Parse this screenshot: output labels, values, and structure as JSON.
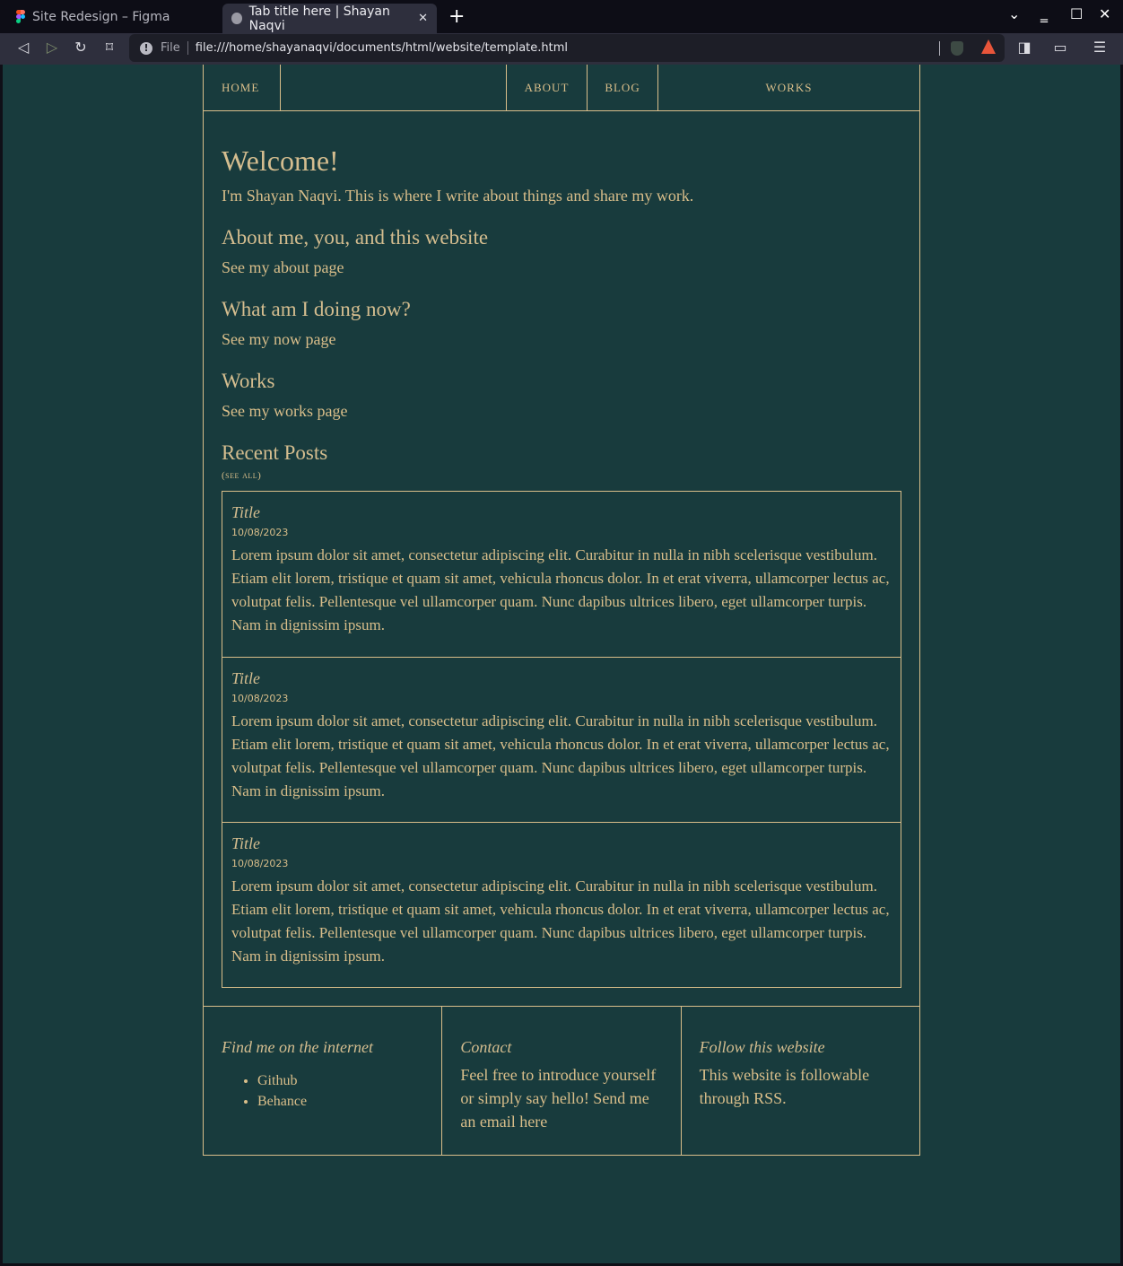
{
  "browser": {
    "tabs": [
      {
        "title": "Site Redesign – Figma",
        "icon": "figma-icon",
        "active": false
      },
      {
        "title": "Tab title here | Shayan Naqvi",
        "icon": "globe-icon",
        "active": true
      }
    ],
    "new_tab_icon": "plus-icon",
    "window_controls": [
      "chevron-down-icon",
      "minimize-icon",
      "maximize-icon",
      "close-icon"
    ],
    "toolbar": {
      "back_icon": "back-icon",
      "forward_icon": "forward-icon",
      "reload_icon": "reload-icon",
      "bookmark_icon": "bookmark-icon",
      "url_scheme_label": "File",
      "url": "file:///home/shayanaqvi/documents/html/website/template.html",
      "extensions": [
        "brave-shields-icon",
        "brave-rewards-icon"
      ],
      "right_icons": [
        "sidebar-icon",
        "wallet-icon",
        "menu-icon"
      ]
    }
  },
  "site": {
    "nav": {
      "home": "HOME",
      "about": "ABOUT",
      "blog": "BLOG",
      "works": "WORKS"
    },
    "welcome": {
      "heading": "Welcome!",
      "intro": "I'm Shayan Naqvi. This is where I write about things and share my work."
    },
    "sections": [
      {
        "heading": "About me, you, and this website",
        "link": "See my about page"
      },
      {
        "heading": "What am I doing now?",
        "link": "See my now page"
      },
      {
        "heading": "Works",
        "link": "See my works page"
      }
    ],
    "recent_posts": {
      "heading": "Recent Posts",
      "see_all": "(see all)",
      "posts": [
        {
          "title": "Title",
          "date": "10/08/2023",
          "body": "Lorem ipsum dolor sit amet, consectetur adipiscing elit. Curabitur in nulla in nibh scelerisque vestibulum. Etiam elit lorem, tristique et quam sit amet, vehicula rhoncus dolor. In et erat viverra, ullamcorper lectus ac, volutpat felis. Pellentesque vel ullamcorper quam. Nunc dapibus ultrices libero, eget ullamcorper turpis. Nam in dignissim ipsum."
        },
        {
          "title": "Title",
          "date": "10/08/2023",
          "body": "Lorem ipsum dolor sit amet, consectetur adipiscing elit. Curabitur in nulla in nibh scelerisque vestibulum. Etiam elit lorem, tristique et quam sit amet, vehicula rhoncus dolor. In et erat viverra, ullamcorper lectus ac, volutpat felis. Pellentesque vel ullamcorper quam. Nunc dapibus ultrices libero, eget ullamcorper turpis. Nam in dignissim ipsum."
        },
        {
          "title": "Title",
          "date": "10/08/2023",
          "body": "Lorem ipsum dolor sit amet, consectetur adipiscing elit. Curabitur in nulla in nibh scelerisque vestibulum. Etiam elit lorem, tristique et quam sit amet, vehicula rhoncus dolor. In et erat viverra, ullamcorper lectus ac, volutpat felis. Pellentesque vel ullamcorper quam. Nunc dapibus ultrices libero, eget ullamcorper turpis. Nam in dignissim ipsum."
        }
      ]
    },
    "footer": {
      "internet": {
        "heading": "Find me on the internet",
        "links": [
          "Github",
          "Behance"
        ]
      },
      "contact": {
        "heading": "Contact",
        "text": "Feel free to introduce yourself or simply say hello! Send me an email here"
      },
      "follow": {
        "heading": "Follow this website",
        "text": "This website is followable through RSS."
      }
    },
    "colors": {
      "background": "#183b3d",
      "accent": "#d9be8a"
    }
  }
}
